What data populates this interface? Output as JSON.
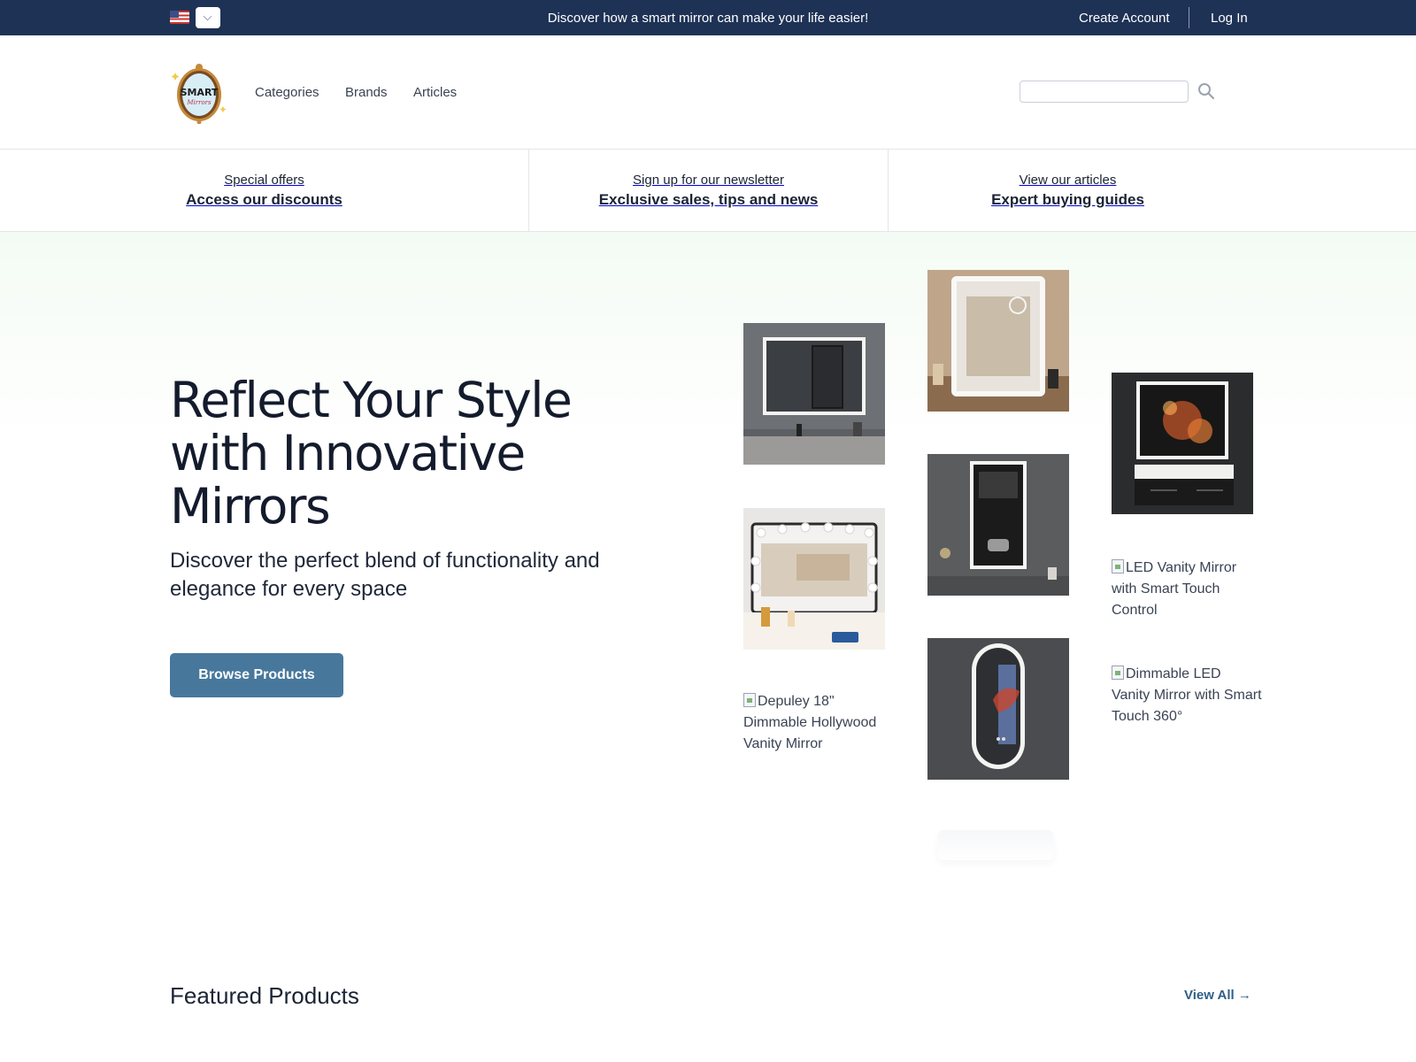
{
  "topbar": {
    "language_flag": "us-flag",
    "announcement": "Discover how a smart mirror can make your life easier!",
    "create_account": "Create Account",
    "login": "Log In"
  },
  "header": {
    "logo_text": "SMART",
    "logo_subtext": "Mirrors",
    "nav": [
      "Categories",
      "Brands",
      "Articles"
    ],
    "search_placeholder": "",
    "search_icon": "magnifier-icon"
  },
  "promo": [
    {
      "pre": "Special offers",
      "main": "Access our discounts"
    },
    {
      "pre": "Sign up for our newsletter",
      "main": "Exclusive sales, tips and news"
    },
    {
      "pre": "View our articles",
      "main": "Expert buying guides"
    }
  ],
  "hero": {
    "title": "Reflect Your Style with Innovative Mirrors",
    "subtitle": "Discover the perfect blend of functionality and elegance for every space",
    "cta": "Browse Products",
    "broken_images": [
      "Depuley 18\" Dimmable Hollywood Vanity Mirror",
      "LED Vanity Mirror with Smart Touch Control",
      "Dimmable LED Vanity Mirror with Smart Touch 360°"
    ]
  },
  "featured": {
    "title": "Featured Products",
    "view_all": "View All →"
  },
  "colors": {
    "topbar_bg": "#1e3255",
    "cta_bg": "#47789c",
    "link_accent": "#2f5f86"
  }
}
